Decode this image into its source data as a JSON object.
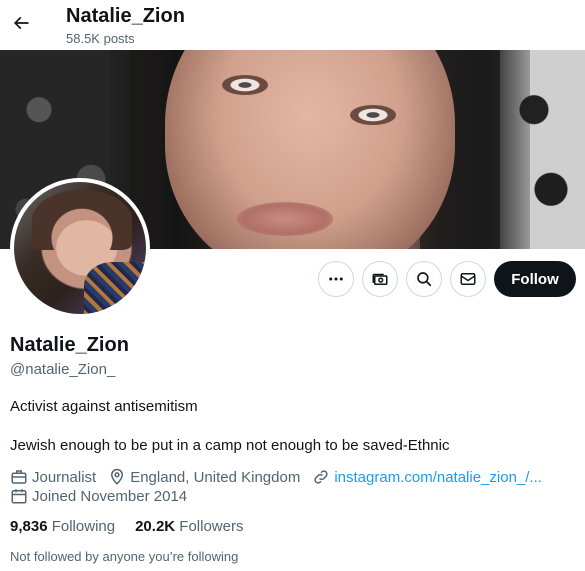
{
  "header": {
    "display_name": "Natalie_Zion",
    "posts_count": "58.5K posts",
    "back_icon": "arrow-left-icon"
  },
  "profile": {
    "display_name": "Natalie_Zion",
    "handle": "@natalie_Zion_",
    "bio_line1": "Activist against antisemitism",
    "bio_line2": "Jewish enough to be put in a camp not enough to be saved-Ethnic",
    "profession": "Journalist",
    "location": "England, United Kingdom",
    "website": "instagram.com/natalie_zion_/...",
    "joined": "Joined November 2014",
    "following_count": "9,836",
    "following_label": "Following",
    "followers_count": "20.2K",
    "followers_label": "Followers",
    "followed_by": "Not followed by anyone you’re following"
  },
  "actions": {
    "more_icon": "more-icon",
    "subscribe_icon": "money-icon",
    "search_icon": "search-icon",
    "message_icon": "envelope-icon",
    "follow_label": "Follow"
  },
  "colors": {
    "text_primary": "#0f1419",
    "text_secondary": "#536471",
    "link": "#1d9bf0",
    "button_dark": "#0f1419",
    "border": "#cfd9de"
  }
}
